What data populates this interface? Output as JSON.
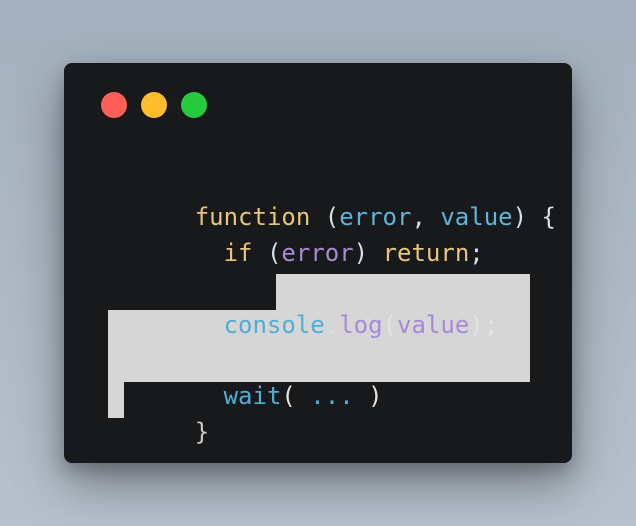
{
  "window": {
    "lights": [
      {
        "name": "close",
        "color": "#ff5f56"
      },
      {
        "name": "minimize",
        "color": "#ffbd2e"
      },
      {
        "name": "maximize",
        "color": "#27c93f"
      }
    ]
  },
  "code": {
    "line1": {
      "keyword": "function",
      "space1": " ",
      "open_paren": "(",
      "param1": "error",
      "comma": ", ",
      "param2": "value",
      "close_paren": ")",
      "space2": " ",
      "open_brace": "{"
    },
    "line2": {
      "indent": "  ",
      "keyword_if": "if",
      "space1": " ",
      "open_paren": "(",
      "condition": "error",
      "close_paren": ")",
      "space2": " ",
      "keyword_return": "return",
      "semicolon": ";"
    },
    "line4": {
      "indent": "  ",
      "object": "console",
      "dot": ".",
      "method": "log",
      "open_paren": "(",
      "argument": "value",
      "close_paren": ")",
      "semicolon": ";"
    },
    "line6": {
      "indent": "  ",
      "function_name": "wait",
      "open_paren": "(",
      "argument": " ... ",
      "close_paren": ")"
    },
    "line7": {
      "closing_brace": "}"
    }
  },
  "colors": {
    "window_background": "#17191b",
    "selection": "#d6d6d6",
    "keyword": "#e8c47c",
    "parameter": "#5fb4d8",
    "purple": "#a68ad6",
    "punctuation": "#d8dee9"
  }
}
